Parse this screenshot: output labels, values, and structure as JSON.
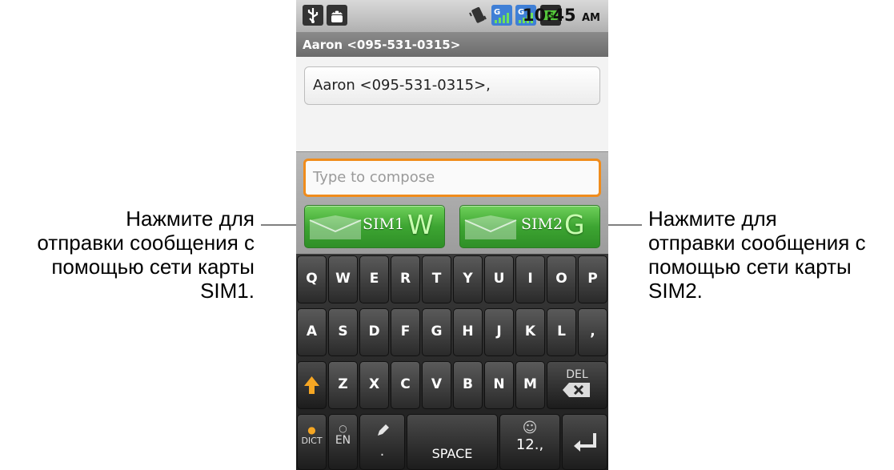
{
  "callouts": {
    "left": [
      "Нажмите для",
      "отправки сообщения с",
      "помощью сети карты",
      "SIM1."
    ],
    "right": [
      "Нажмите для",
      "отправки сообщения с",
      "помощью сети карты",
      "SIM2."
    ]
  },
  "status_bar": {
    "time": "10:45",
    "ampm": "AM",
    "icons": [
      "usb-icon",
      "android-icon",
      "vibrate-icon",
      "signal-g-icon",
      "signal-g-icon",
      "battery-charging-icon"
    ]
  },
  "conversation": {
    "title": "Aaron <095-531-0315>",
    "to_value": "Aaron <095-531-0315>,"
  },
  "compose": {
    "placeholder": "Type to compose",
    "send_sim1": {
      "label": "SIM1",
      "badge": "W"
    },
    "send_sim2": {
      "label": "SIM2",
      "badge": "G"
    }
  },
  "keyboard": {
    "row1": [
      "Q",
      "W",
      "E",
      "R",
      "T",
      "Y",
      "U",
      "I",
      "O",
      "P"
    ],
    "row2": [
      "A",
      "S",
      "D",
      "F",
      "G",
      "H",
      "J",
      "K",
      "L",
      ","
    ],
    "row3": [
      "Z",
      "X",
      "C",
      "V",
      "B",
      "N",
      "M"
    ],
    "del_label": "DEL",
    "dict_label": "DICT",
    "lang_label": "EN",
    "period_label": ".",
    "space_label": "SPACE",
    "sym_label": "12.,"
  },
  "colors": {
    "accent_focus": "#f08c1c",
    "send_button_green": "#3da532"
  }
}
